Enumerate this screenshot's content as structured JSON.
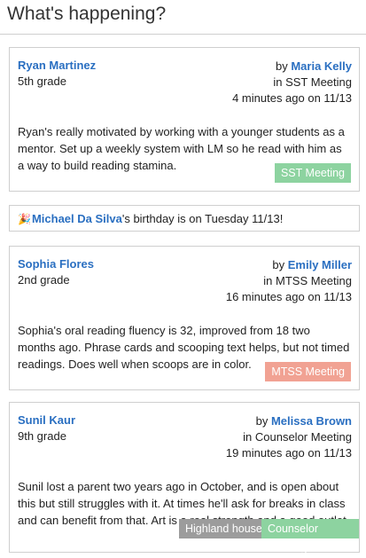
{
  "page_title": "What's happening?",
  "cards": [
    {
      "name": "Ryan Martinez",
      "grade": "5th grade",
      "by_label": "by",
      "author": "Maria Kelly",
      "meeting": "in SST Meeting",
      "time": "4 minutes ago on 11/13",
      "body": "Ryan's really motivated by working with a younger students as a mentor. Set up a weekly system with LM so he read with him as a way to build reading stamina.",
      "tags": [
        "SST Meeting"
      ]
    },
    {
      "name": "Sophia Flores",
      "grade": "2nd grade",
      "by_label": "by",
      "author": "Emily Miller",
      "meeting": "in MTSS Meeting",
      "time": "16 minutes ago on 11/13",
      "body": "Sophia's oral reading fluency is 32, improved from 18 two months ago. Phrase cards and scooping text helps, but not timed readings.  Does well when scoops are in color.",
      "tags": [
        "MTSS Meeting"
      ]
    },
    {
      "name": "Sunil Kaur",
      "grade": "9th grade",
      "by_label": "by",
      "author": "Melissa Brown",
      "meeting": "in Counselor Meeting",
      "time": "19 minutes ago on 11/13",
      "body": "Sunil lost a parent two years ago in October, and is open about this but still struggles with it.  At times he'll ask for breaks in class and can benefit from that.  Art is a real strength and a good outlet.",
      "tags": [
        "Highland house",
        "Counselor Meeting"
      ]
    }
  ],
  "birthday": {
    "icon": "birthday-cake-icon",
    "person": "Michael Da Silva",
    "text": "'s birthday is on Tuesday 11/13!"
  }
}
